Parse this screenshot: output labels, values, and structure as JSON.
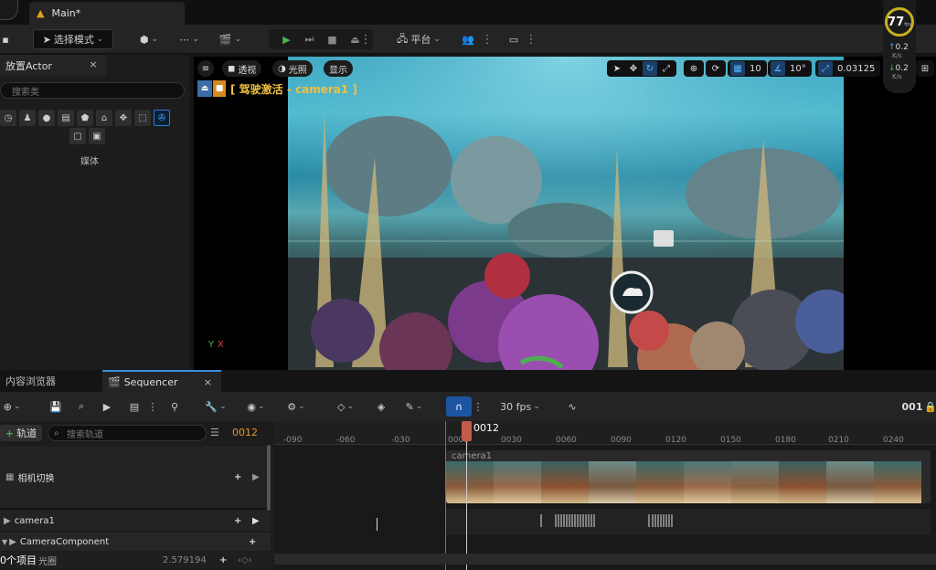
{
  "window": {
    "tab_title": "Main*"
  },
  "toolbar": {
    "mode_label": "选择模式",
    "platform_label": "平台"
  },
  "place_actor": {
    "tab_label": "放置Actor",
    "close": "×",
    "search_placeholder": "搜索类",
    "category_label": "媒体"
  },
  "viewport": {
    "perspective": "透视",
    "lighting": "光照",
    "show": "显示",
    "camera_label": "[ 驾驶激活 - camera1 ]",
    "grid_snap": "10",
    "rotation_snap": "10°",
    "scale_snap": "0.03125",
    "axis_y": "Y",
    "axis_x": "X"
  },
  "stats": {
    "fps": "77",
    "fps_unit": "fps",
    "up_value": "0.2",
    "up_unit": "K/s",
    "down_value": "0.2",
    "down_unit": "K/s"
  },
  "bottom_tabs": {
    "content_browser": "内容浏览器",
    "sequencer": "Sequencer",
    "close": "×"
  },
  "sequencer": {
    "fps_label": "30 fps",
    "frame_right": "001",
    "add_track": "轨道",
    "search_placeholder": "搜索轨道",
    "current_frame": "0012",
    "playhead_label": "0012",
    "ruler_ticks": [
      "-090",
      "-060",
      "-030",
      "0000",
      "0030",
      "0060",
      "0090",
      "0120",
      "0150",
      "0180",
      "0210",
      "0240"
    ],
    "tracks": [
      {
        "name": "相机切换"
      },
      {
        "name": "camera1"
      },
      {
        "name": "CameraComponent"
      },
      {
        "name": "光圈",
        "value": "2.579194"
      }
    ],
    "clip_label": "camera1",
    "item_count": "0个项目"
  },
  "colors": {
    "accent": "#2a7ed6",
    "playhead": "#c45a4a",
    "frame_text": "#e09a2e",
    "camera_label": "#f0c040",
    "play_green": "#4caf50"
  }
}
